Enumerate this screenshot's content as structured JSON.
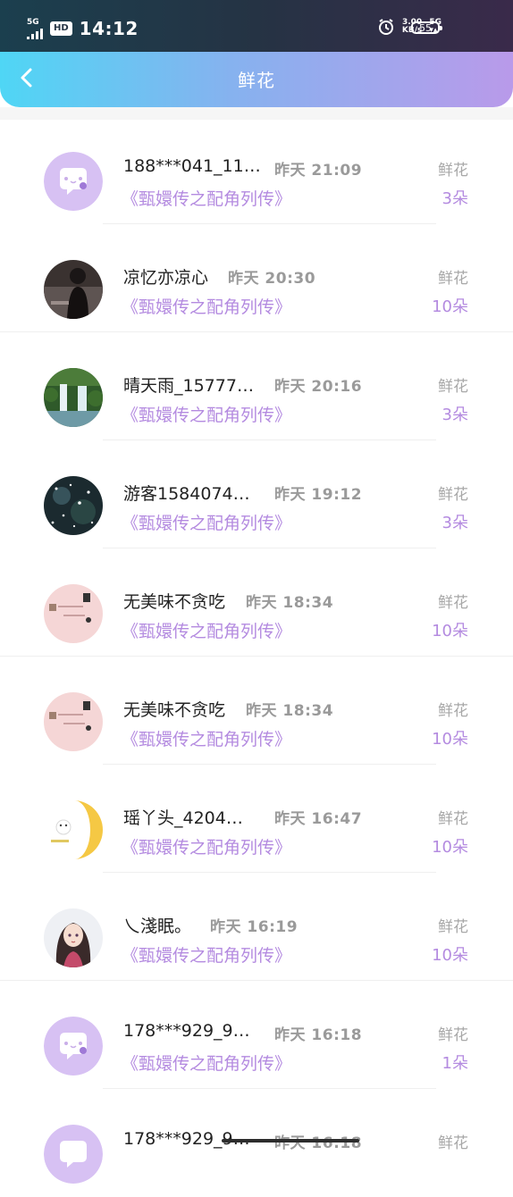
{
  "status_bar": {
    "network": "5G",
    "hd": "HD",
    "time": "14:12",
    "speed_value": "3.00",
    "speed_unit": "KB/s",
    "network2": "5G",
    "battery": "55"
  },
  "nav": {
    "title": "鲜花"
  },
  "colors": {
    "accent": "#b48be0",
    "header_start": "#4fd6f5",
    "header_end": "#b99aea"
  },
  "rows": [
    {
      "name": "188***041_11…",
      "time": "昨天 21:09",
      "book": "《甄嬛传之配角列传》",
      "flower_label": "鲜花",
      "count": "3朵",
      "avatar": "default-chat-avatar"
    },
    {
      "name": "凉忆亦凉心",
      "time": "昨天 20:30",
      "book": "《甄嬛传之配角列传》",
      "flower_label": "鲜花",
      "count": "10朵",
      "avatar": "dark-photo-avatar"
    },
    {
      "name": "晴天雨_15777…",
      "time": "昨天 20:16",
      "book": "《甄嬛传之配角列传》",
      "flower_label": "鲜花",
      "count": "3朵",
      "avatar": "waterfall-avatar"
    },
    {
      "name": "游客1584074…",
      "time": "昨天 19:12",
      "book": "《甄嬛传之配角列传》",
      "flower_label": "鲜花",
      "count": "3朵",
      "avatar": "starry-avatar"
    },
    {
      "name": "无美味不贪吃",
      "time": "昨天 18:34",
      "book": "《甄嬛传之配角列传》",
      "flower_label": "鲜花",
      "count": "10朵",
      "avatar": "pink-note-avatar"
    },
    {
      "name": "无美味不贪吃",
      "time": "昨天 18:34",
      "book": "《甄嬛传之配角列传》",
      "flower_label": "鲜花",
      "count": "10朵",
      "avatar": "pink-note-avatar"
    },
    {
      "name": "瑶丫头_4204…",
      "time": "昨天 16:47",
      "book": "《甄嬛传之配角列传》",
      "flower_label": "鲜花",
      "count": "10朵",
      "avatar": "yellow-moon-avatar"
    },
    {
      "name": "乀淺眠。",
      "time": "昨天 16:19",
      "book": "《甄嬛传之配角列传》",
      "flower_label": "鲜花",
      "count": "10朵",
      "avatar": "anime-girl-avatar"
    },
    {
      "name": "178***929_9…",
      "time": "昨天 16:18",
      "book": "《甄嬛传之配角列传》",
      "flower_label": "鲜花",
      "count": "1朵",
      "avatar": "default-chat-avatar"
    },
    {
      "name": "178***929_9…",
      "time": "昨天 16:18",
      "book": "",
      "flower_label": "鲜花",
      "count": "",
      "avatar": "default-chat-avatar"
    }
  ]
}
